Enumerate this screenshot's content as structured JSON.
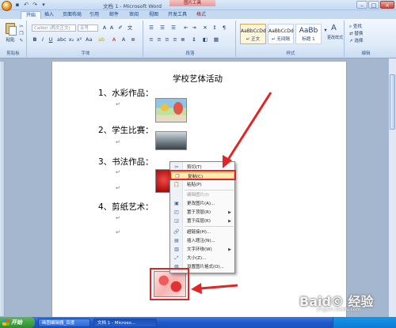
{
  "window": {
    "title": "文档 1 - Microsoft Word",
    "context_tools": "图片工具",
    "minimize": "–",
    "maximize": "□",
    "close": "×"
  },
  "tabs": [
    "开始",
    "插入",
    "页面布局",
    "引用",
    "邮件",
    "审阅",
    "视图",
    "开发工具",
    "格式"
  ],
  "ribbon": {
    "clipboard": {
      "paste": "粘贴",
      "label": "剪贴板"
    },
    "font": {
      "name": "Calibri (西文正文)",
      "size": "五号",
      "label": "字体",
      "bold": "B",
      "italic": "I",
      "underline": "U"
    },
    "paragraph": {
      "label": "段落"
    },
    "styles": {
      "items": [
        {
          "sample": "AaBbCcDd",
          "name": "↵ 正文"
        },
        {
          "sample": "AaBbCcDd",
          "name": "↵ 无间隔"
        },
        {
          "sample": "AaBb",
          "name": "标题 1"
        }
      ],
      "change": "更改样式",
      "label": "样式"
    },
    "editing": {
      "find": "查找",
      "replace": "替换",
      "select": "选择",
      "label": "编辑"
    }
  },
  "document": {
    "title": "学校艺体活动",
    "items": [
      "1、水彩作品：",
      "2、学生比赛：",
      "3、书法作品：",
      "4、剪纸艺术："
    ]
  },
  "context_menu": {
    "items": [
      {
        "label": "剪切(T)",
        "icon": "scissors-icon",
        "disabled": false,
        "submenu": false
      },
      {
        "label": "复制(C)",
        "icon": "copy-icon",
        "disabled": false,
        "submenu": false,
        "highlighted": true
      },
      {
        "label": "粘贴(P)",
        "icon": "paste-icon",
        "disabled": false,
        "submenu": false
      },
      {
        "label": "编辑图片(I)",
        "icon": "",
        "disabled": true,
        "submenu": false
      },
      {
        "label": "更改图片(A)...",
        "icon": "change-picture-icon",
        "disabled": false,
        "submenu": false
      },
      {
        "label": "置于顶层(R)",
        "icon": "bring-front-icon",
        "disabled": false,
        "submenu": true
      },
      {
        "label": "置于底层(K)",
        "icon": "send-back-icon",
        "disabled": false,
        "submenu": true
      },
      {
        "label": "超链接(H)...",
        "icon": "hyperlink-icon",
        "disabled": false,
        "submenu": false
      },
      {
        "label": "插入题注(N)...",
        "icon": "caption-icon",
        "disabled": false,
        "submenu": false
      },
      {
        "label": "文字环绕(W)",
        "icon": "wrap-text-icon",
        "disabled": false,
        "submenu": true
      },
      {
        "label": "大小(Z)...",
        "icon": "size-icon",
        "disabled": false,
        "submenu": false
      },
      {
        "label": "设置图片格式(O)...",
        "icon": "format-picture-icon",
        "disabled": false,
        "submenu": false
      }
    ]
  },
  "taskbar": {
    "start": "开始",
    "items": [
      "画图编辑器_百度",
      "文档 1 - Microso..."
    ]
  },
  "watermark": {
    "main": "Baid© 经验",
    "sub": "jingyan.baidu.com"
  },
  "colors": {
    "highlight_box": "#e02525",
    "ribbon_bg": "#dde9f8",
    "taskbar": "#2258c9"
  }
}
